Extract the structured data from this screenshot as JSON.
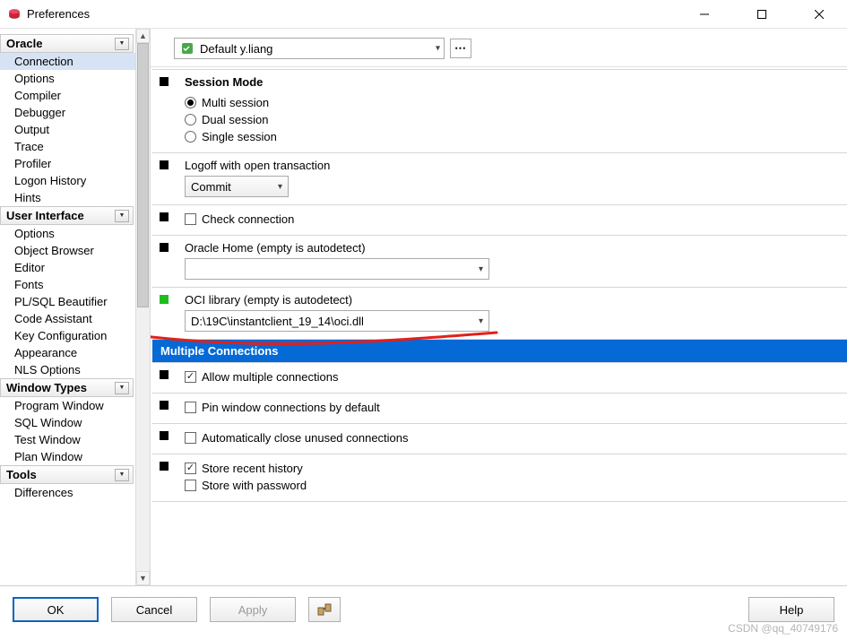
{
  "window": {
    "title": "Preferences"
  },
  "profile": {
    "selected": "Default y.liang"
  },
  "sidebar": {
    "sections": [
      {
        "title": "Oracle",
        "items": [
          "Connection",
          "Options",
          "Compiler",
          "Debugger",
          "Output",
          "Trace",
          "Profiler",
          "Logon History",
          "Hints"
        ],
        "selected_index": 0
      },
      {
        "title": "User Interface",
        "items": [
          "Options",
          "Object Browser",
          "Editor",
          "Fonts",
          "PL/SQL Beautifier",
          "Code Assistant",
          "Key Configuration",
          "Appearance",
          "NLS Options"
        ]
      },
      {
        "title": "Window Types",
        "items": [
          "Program Window",
          "SQL Window",
          "Test Window",
          "Plan Window"
        ]
      },
      {
        "title": "Tools",
        "items": [
          "Differences"
        ]
      }
    ]
  },
  "settings": {
    "session_mode": {
      "title": "Session Mode",
      "options": [
        "Multi session",
        "Dual session",
        "Single session"
      ],
      "selected": "Multi session"
    },
    "logoff": {
      "label": "Logoff with open transaction",
      "value": "Commit"
    },
    "check_connection": {
      "label": "Check connection",
      "checked": false
    },
    "oracle_home": {
      "label": "Oracle Home (empty is autodetect)",
      "value": ""
    },
    "oci_library": {
      "label": "OCI library (empty is autodetect)",
      "value": "D:\\19C\\instantclient_19_14\\oci.dll"
    },
    "multiple_connections_heading": "Multiple Connections",
    "allow_multiple": {
      "label": "Allow multiple connections",
      "checked": true
    },
    "pin_window": {
      "label": "Pin window connections by default",
      "checked": false
    },
    "auto_close": {
      "label": "Automatically close unused connections",
      "checked": false
    },
    "store_recent": {
      "label": "Store recent history",
      "checked": true
    },
    "store_password": {
      "label": "Store with password",
      "checked": false
    }
  },
  "buttons": {
    "ok": "OK",
    "cancel": "Cancel",
    "apply": "Apply",
    "help": "Help"
  },
  "watermark": "CSDN @qq_40749176"
}
